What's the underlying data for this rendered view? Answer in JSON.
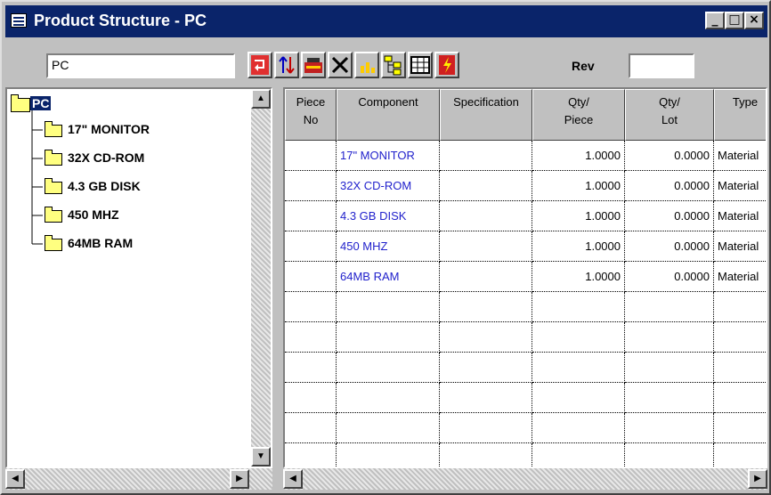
{
  "window": {
    "title": "Product Structure - PC",
    "controls": [
      "_",
      "□",
      "×"
    ]
  },
  "toolbar": {
    "item_value": "PC",
    "rev_label": "Rev",
    "rev_value": "",
    "buttons": [
      "back-arrow-icon",
      "sort-icon",
      "mixer-icon",
      "delete-icon",
      "chart-icon",
      "tree-icon",
      "grid-icon",
      "lightning-icon"
    ]
  },
  "tree": {
    "root": "PC",
    "children": [
      "17\" MONITOR",
      "32X CD-ROM",
      "4.3 GB DISK",
      "450 MHZ",
      "64MB RAM"
    ]
  },
  "grid": {
    "columns": [
      {
        "label": "Piece\nNo"
      },
      {
        "label": "Component"
      },
      {
        "label": "Specification"
      },
      {
        "label": "Qty/\nPiece"
      },
      {
        "label": "Qty/\nLot"
      },
      {
        "label": "Type"
      }
    ],
    "rows": [
      {
        "piece": "",
        "component": "17\" MONITOR",
        "spec": "",
        "qty_piece": "1.0000",
        "qty_lot": "0.0000",
        "type": "Material"
      },
      {
        "piece": "",
        "component": "32X CD-ROM",
        "spec": "",
        "qty_piece": "1.0000",
        "qty_lot": "0.0000",
        "type": "Material"
      },
      {
        "piece": "",
        "component": "4.3 GB DISK",
        "spec": "",
        "qty_piece": "1.0000",
        "qty_lot": "0.0000",
        "type": "Material"
      },
      {
        "piece": "",
        "component": "450 MHZ",
        "spec": "",
        "qty_piece": "1.0000",
        "qty_lot": "0.0000",
        "type": "Material"
      },
      {
        "piece": "",
        "component": "64MB RAM",
        "spec": "",
        "qty_piece": "1.0000",
        "qty_lot": "0.0000",
        "type": "Material"
      }
    ],
    "link_color": "#2222cc"
  }
}
